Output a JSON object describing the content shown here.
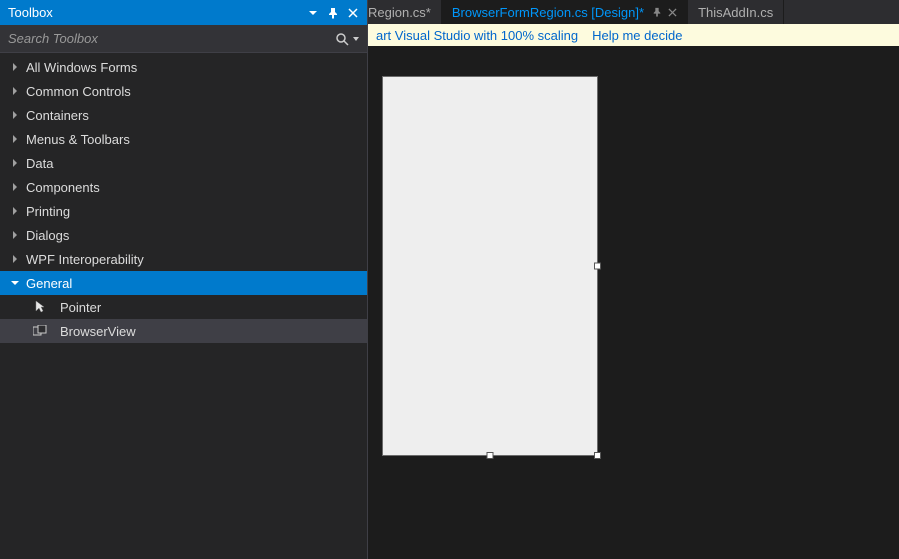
{
  "toolbox": {
    "title": "Toolbox",
    "search_placeholder": "Search Toolbox",
    "categories": [
      {
        "label": "All Windows Forms",
        "expanded": false
      },
      {
        "label": "Common Controls",
        "expanded": false
      },
      {
        "label": "Containers",
        "expanded": false
      },
      {
        "label": "Menus & Toolbars",
        "expanded": false
      },
      {
        "label": "Data",
        "expanded": false
      },
      {
        "label": "Components",
        "expanded": false
      },
      {
        "label": "Printing",
        "expanded": false
      },
      {
        "label": "Dialogs",
        "expanded": false
      },
      {
        "label": "WPF Interoperability",
        "expanded": false
      },
      {
        "label": "General",
        "expanded": true
      }
    ],
    "general_items": [
      {
        "label": "Pointer",
        "icon": "pointer",
        "selected": false
      },
      {
        "label": "BrowserView",
        "icon": "control",
        "selected": true
      }
    ]
  },
  "tabs": [
    {
      "label": "Region.cs*",
      "cut_left": true,
      "active": false,
      "pinned": false,
      "closeable": false
    },
    {
      "label": "BrowserFormRegion.cs [Design]*",
      "active": true,
      "pinned": true,
      "closeable": true
    },
    {
      "label": "ThisAddIn.cs",
      "active": false,
      "pinned": false,
      "closeable": false
    }
  ],
  "infobar": {
    "link1": "art Visual Studio with 100% scaling",
    "link2": "Help me decide"
  }
}
